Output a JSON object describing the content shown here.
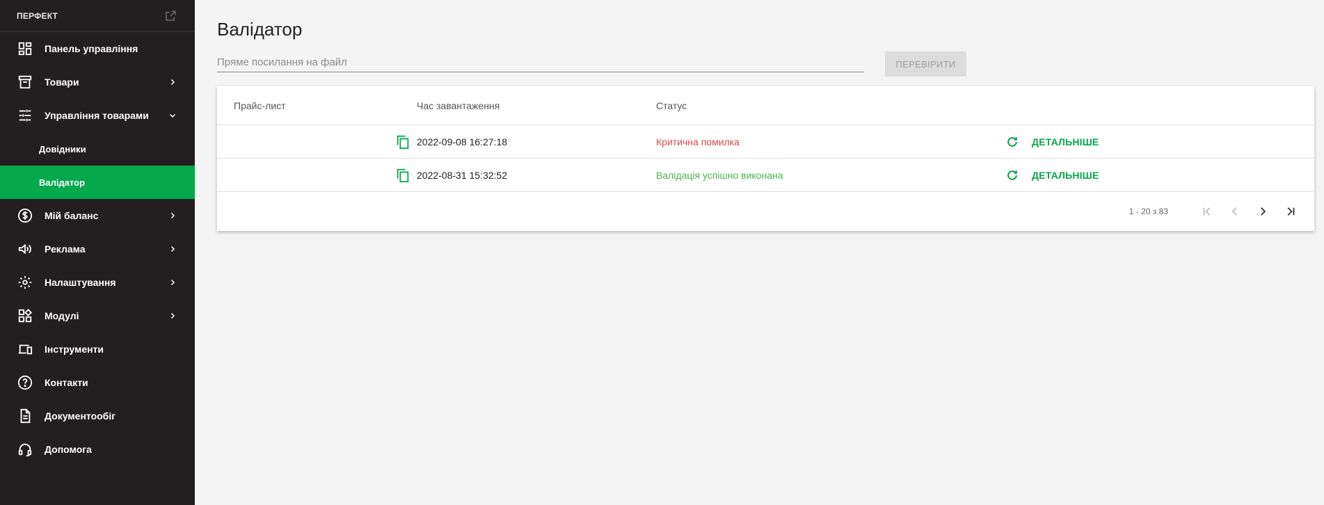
{
  "sidebar": {
    "brand": "ПЕРФЕКТ",
    "items": [
      {
        "label": "Панель управління",
        "icon": "dashboard-icon"
      },
      {
        "label": "Товари",
        "icon": "archive-icon"
      },
      {
        "label": "Управління товарами",
        "icon": "tune-icon"
      },
      {
        "label": "Довідники"
      },
      {
        "label": "Валідатор"
      },
      {
        "label": "Мій баланс",
        "icon": "dollar-icon"
      },
      {
        "label": "Реклама",
        "icon": "megaphone-icon"
      },
      {
        "label": "Налаштування",
        "icon": "gear-icon"
      },
      {
        "label": "Модулі",
        "icon": "widgets-icon"
      },
      {
        "label": "Інструменти",
        "icon": "devices-icon"
      },
      {
        "label": "Контакти",
        "icon": "help-icon"
      },
      {
        "label": "Документообіг",
        "icon": "document-icon"
      },
      {
        "label": "Допомога",
        "icon": "headset-icon"
      }
    ]
  },
  "main": {
    "title": "Валідатор",
    "url_placeholder": "Пряме посилання на файл",
    "check_button": "ПЕРЕВІРИТИ",
    "table": {
      "headers": [
        "Прайс-лист",
        "Час завантаження",
        "Статус"
      ],
      "rows": [
        {
          "time": "2022-09-08 16:27:18",
          "status": "Критична помилка",
          "details": "ДЕТАЛЬНІШЕ"
        },
        {
          "time": "2022-08-31 15:32:52",
          "status": "Валідація успішно виконана",
          "details": "ДЕТАЛЬНІШЕ"
        }
      ]
    },
    "pagination": {
      "range": "1 - 20 з 83"
    }
  },
  "colors": {
    "sidebar_bg": "#231f20",
    "accent": "#06a84c",
    "error": "#e0464d",
    "success": "#4caf50"
  }
}
